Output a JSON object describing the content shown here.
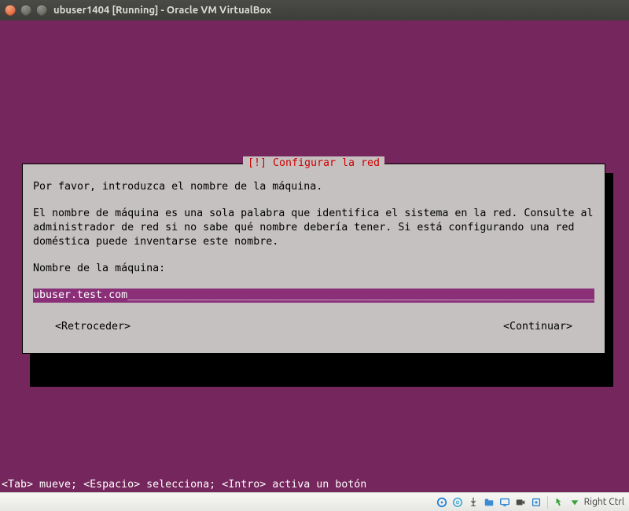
{
  "window": {
    "title": "ubuser1404 [Running] - Oracle VM VirtualBox"
  },
  "installer": {
    "dialog_title": "[!] Configurar la red",
    "prompt": "Por favor, introduzca el nombre de la máquina.",
    "explanation": "El nombre de máquina es una sola palabra que identifica el sistema en la red. Consulte al administrador de red si no sabe qué nombre debería tener. Si está configurando una red doméstica puede inventarse este nombre.",
    "field_label": "Nombre de la máquina:",
    "field_value": "ubuser.test.com",
    "back_label": "<Retroceder>",
    "continue_label": "<Continuar>",
    "help_line": "<Tab> mueve; <Espacio> selecciona; <Intro> activa un botón"
  },
  "statusbar": {
    "hostkey_label": "Right Ctrl"
  },
  "colors": {
    "installer_bg": "#75265c",
    "dialog_bg": "#c5c1c1",
    "title_accent": "#d00000",
    "field_bg": "#8a2f78"
  }
}
